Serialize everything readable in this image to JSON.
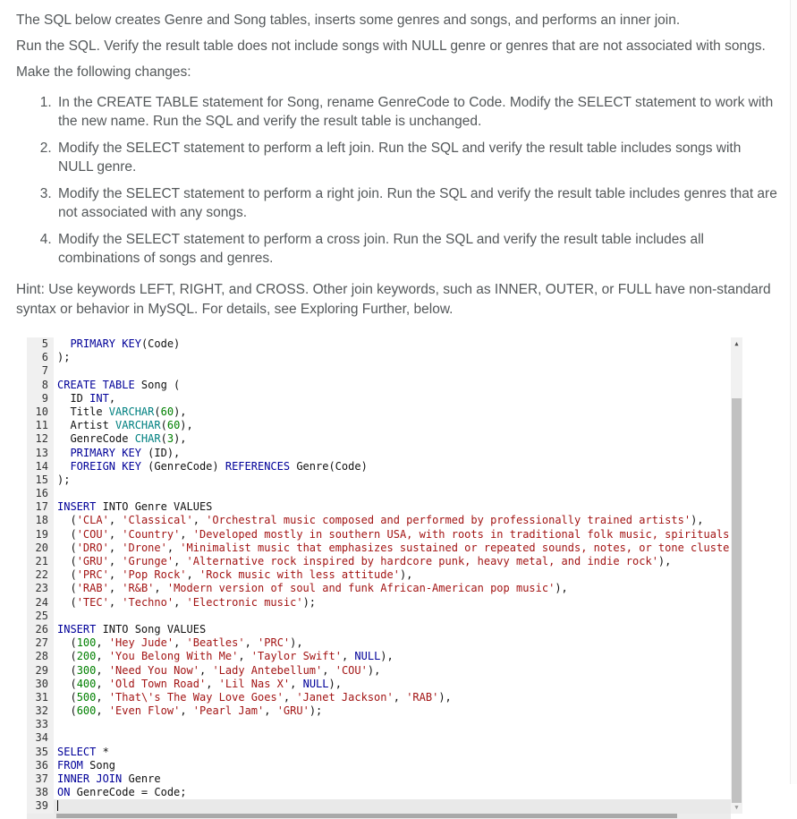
{
  "instructions": {
    "para1": "The SQL below creates Genre and Song tables, inserts some genres and songs, and performs an inner join.",
    "para2": "Run the SQL. Verify the result table does not include songs with NULL genre or genres that are not associated with songs.",
    "para3": "Make the following changes:",
    "items": [
      "In the CREATE TABLE statement for Song, rename GenreCode to Code. Modify the SELECT statement to work with the new name. Run the SQL and verify the result table is unchanged.",
      "Modify the SELECT statement to perform a left join. Run the SQL and verify the result table includes songs with NULL genre.",
      "Modify the SELECT statement to perform a right join. Run the SQL and verify the result table includes genres that are not associated with any songs.",
      "Modify the SELECT statement to perform a cross join. Run the SQL and verify the result table includes all combinations of songs and genres."
    ],
    "hint": "Hint: Use keywords LEFT, RIGHT, and CROSS. Other join keywords, such as INNER, OUTER, or FULL have non-standard syntax or behavior in MySQL. For details, see Exploring Further, below."
  },
  "editor": {
    "first_visible_line": 5,
    "last_visible_line": 39,
    "active_line": 39,
    "colors": {
      "keyword": "#000099",
      "type": "#008080",
      "number": "#008000",
      "string": "#a31515",
      "plain": "#111111",
      "gutter_bg": "#f0f0f0",
      "gutter_text": "#333333",
      "active_line_bg": "#e9e9e9"
    },
    "lines": [
      {
        "no": 5,
        "tokens": [
          [
            "p",
            "  "
          ],
          [
            "k",
            "PRIMARY KEY"
          ],
          [
            "p",
            "(Code)"
          ]
        ]
      },
      {
        "no": 6,
        "tokens": [
          [
            "p",
            ");"
          ]
        ]
      },
      {
        "no": 7,
        "tokens": []
      },
      {
        "no": 8,
        "tokens": [
          [
            "k",
            "CREATE TABLE"
          ],
          [
            "p",
            " Song ("
          ]
        ]
      },
      {
        "no": 9,
        "tokens": [
          [
            "p",
            "  ID "
          ],
          [
            "k",
            "INT"
          ],
          [
            "p",
            ","
          ]
        ]
      },
      {
        "no": 10,
        "tokens": [
          [
            "p",
            "  Title "
          ],
          [
            "t",
            "VARCHAR"
          ],
          [
            "p",
            "("
          ],
          [
            "n",
            "60"
          ],
          [
            "p",
            "),"
          ]
        ]
      },
      {
        "no": 11,
        "tokens": [
          [
            "p",
            "  Artist "
          ],
          [
            "t",
            "VARCHAR"
          ],
          [
            "p",
            "("
          ],
          [
            "n",
            "60"
          ],
          [
            "p",
            "),"
          ]
        ]
      },
      {
        "no": 12,
        "tokens": [
          [
            "p",
            "  GenreCode "
          ],
          [
            "t",
            "CHAR"
          ],
          [
            "p",
            "("
          ],
          [
            "n",
            "3"
          ],
          [
            "p",
            "),"
          ]
        ]
      },
      {
        "no": 13,
        "tokens": [
          [
            "p",
            "  "
          ],
          [
            "k",
            "PRIMARY KEY"
          ],
          [
            "p",
            " (ID),"
          ]
        ]
      },
      {
        "no": 14,
        "tokens": [
          [
            "p",
            "  "
          ],
          [
            "k",
            "FOREIGN KEY"
          ],
          [
            "p",
            " (GenreCode) "
          ],
          [
            "k",
            "REFERENCES"
          ],
          [
            "p",
            " Genre(Code)"
          ]
        ]
      },
      {
        "no": 15,
        "tokens": [
          [
            "p",
            ");"
          ]
        ]
      },
      {
        "no": 16,
        "tokens": []
      },
      {
        "no": 17,
        "tokens": [
          [
            "k",
            "INSERT"
          ],
          [
            "p",
            " INTO Genre VALUES"
          ]
        ]
      },
      {
        "no": 18,
        "tokens": [
          [
            "p",
            "  ("
          ],
          [
            "s",
            "'CLA'"
          ],
          [
            "p",
            ", "
          ],
          [
            "s",
            "'Classical'"
          ],
          [
            "p",
            ", "
          ],
          [
            "s",
            "'Orchestral music composed and performed by professionally trained artists'"
          ],
          [
            "p",
            "),"
          ]
        ]
      },
      {
        "no": 19,
        "tokens": [
          [
            "p",
            "  ("
          ],
          [
            "s",
            "'COU'"
          ],
          [
            "p",
            ", "
          ],
          [
            "s",
            "'Country'"
          ],
          [
            "p",
            ", "
          ],
          [
            "s",
            "'Developed mostly in southern USA, with roots in traditional folk music, spirituals and"
          ]
        ]
      },
      {
        "no": 20,
        "tokens": [
          [
            "p",
            "  ("
          ],
          [
            "s",
            "'DRO'"
          ],
          [
            "p",
            ", "
          ],
          [
            "s",
            "'Drone'"
          ],
          [
            "p",
            ", "
          ],
          [
            "s",
            "'Minimalist music that emphasizes sustained or repeated sounds, notes, or tone clusters'"
          ],
          [
            "p",
            "),"
          ]
        ]
      },
      {
        "no": 21,
        "tokens": [
          [
            "p",
            "  ("
          ],
          [
            "s",
            "'GRU'"
          ],
          [
            "p",
            ", "
          ],
          [
            "s",
            "'Grunge'"
          ],
          [
            "p",
            ", "
          ],
          [
            "s",
            "'Alternative rock inspired by hardcore punk, heavy metal, and indie rock'"
          ],
          [
            "p",
            "),"
          ]
        ]
      },
      {
        "no": 22,
        "tokens": [
          [
            "p",
            "  ("
          ],
          [
            "s",
            "'PRC'"
          ],
          [
            "p",
            ", "
          ],
          [
            "s",
            "'Pop Rock'"
          ],
          [
            "p",
            ", "
          ],
          [
            "s",
            "'Rock music with less attitude'"
          ],
          [
            "p",
            "),"
          ]
        ]
      },
      {
        "no": 23,
        "tokens": [
          [
            "p",
            "  ("
          ],
          [
            "s",
            "'RAB'"
          ],
          [
            "p",
            ", "
          ],
          [
            "s",
            "'R&B'"
          ],
          [
            "p",
            ", "
          ],
          [
            "s",
            "'Modern version of soul and funk African-American pop music'"
          ],
          [
            "p",
            "),"
          ]
        ]
      },
      {
        "no": 24,
        "tokens": [
          [
            "p",
            "  ("
          ],
          [
            "s",
            "'TEC'"
          ],
          [
            "p",
            ", "
          ],
          [
            "s",
            "'Techno'"
          ],
          [
            "p",
            ", "
          ],
          [
            "s",
            "'Electronic music'"
          ],
          [
            "p",
            ");"
          ]
        ]
      },
      {
        "no": 25,
        "tokens": []
      },
      {
        "no": 26,
        "tokens": [
          [
            "k",
            "INSERT"
          ],
          [
            "p",
            " INTO Song VALUES"
          ]
        ]
      },
      {
        "no": 27,
        "tokens": [
          [
            "p",
            "  ("
          ],
          [
            "n",
            "100"
          ],
          [
            "p",
            ", "
          ],
          [
            "s",
            "'Hey Jude'"
          ],
          [
            "p",
            ", "
          ],
          [
            "s",
            "'Beatles'"
          ],
          [
            "p",
            ", "
          ],
          [
            "s",
            "'PRC'"
          ],
          [
            "p",
            "),"
          ]
        ]
      },
      {
        "no": 28,
        "tokens": [
          [
            "p",
            "  ("
          ],
          [
            "n",
            "200"
          ],
          [
            "p",
            ", "
          ],
          [
            "s",
            "'You Belong With Me'"
          ],
          [
            "p",
            ", "
          ],
          [
            "s",
            "'Taylor Swift'"
          ],
          [
            "p",
            ", "
          ],
          [
            "k",
            "NULL"
          ],
          [
            "p",
            "),"
          ]
        ]
      },
      {
        "no": 29,
        "tokens": [
          [
            "p",
            "  ("
          ],
          [
            "n",
            "300"
          ],
          [
            "p",
            ", "
          ],
          [
            "s",
            "'Need You Now'"
          ],
          [
            "p",
            ", "
          ],
          [
            "s",
            "'Lady Antebellum'"
          ],
          [
            "p",
            ", "
          ],
          [
            "s",
            "'COU'"
          ],
          [
            "p",
            "),"
          ]
        ]
      },
      {
        "no": 30,
        "tokens": [
          [
            "p",
            "  ("
          ],
          [
            "n",
            "400"
          ],
          [
            "p",
            ", "
          ],
          [
            "s",
            "'Old Town Road'"
          ],
          [
            "p",
            ", "
          ],
          [
            "s",
            "'Lil Nas X'"
          ],
          [
            "p",
            ", "
          ],
          [
            "k",
            "NULL"
          ],
          [
            "p",
            "),"
          ]
        ]
      },
      {
        "no": 31,
        "tokens": [
          [
            "p",
            "  ("
          ],
          [
            "n",
            "500"
          ],
          [
            "p",
            ", "
          ],
          [
            "s",
            "'That\\'s The Way Love Goes'"
          ],
          [
            "p",
            ", "
          ],
          [
            "s",
            "'Janet Jackson'"
          ],
          [
            "p",
            ", "
          ],
          [
            "s",
            "'RAB'"
          ],
          [
            "p",
            "),"
          ]
        ]
      },
      {
        "no": 32,
        "tokens": [
          [
            "p",
            "  ("
          ],
          [
            "n",
            "600"
          ],
          [
            "p",
            ", "
          ],
          [
            "s",
            "'Even Flow'"
          ],
          [
            "p",
            ", "
          ],
          [
            "s",
            "'Pearl Jam'"
          ],
          [
            "p",
            ", "
          ],
          [
            "s",
            "'GRU'"
          ],
          [
            "p",
            ");"
          ]
        ]
      },
      {
        "no": 33,
        "tokens": []
      },
      {
        "no": 34,
        "tokens": []
      },
      {
        "no": 35,
        "tokens": [
          [
            "k",
            "SELECT"
          ],
          [
            "p",
            " *"
          ]
        ]
      },
      {
        "no": 36,
        "tokens": [
          [
            "k",
            "FROM"
          ],
          [
            "p",
            " Song"
          ]
        ]
      },
      {
        "no": 37,
        "tokens": [
          [
            "k",
            "INNER JOIN"
          ],
          [
            "p",
            " Genre"
          ]
        ]
      },
      {
        "no": 38,
        "tokens": [
          [
            "k",
            "ON"
          ],
          [
            "p",
            " GenreCode = Code;"
          ]
        ]
      },
      {
        "no": 39,
        "tokens": []
      }
    ],
    "scrollbar": {
      "up_arrow": "▲",
      "down_arrow": "▼"
    }
  }
}
